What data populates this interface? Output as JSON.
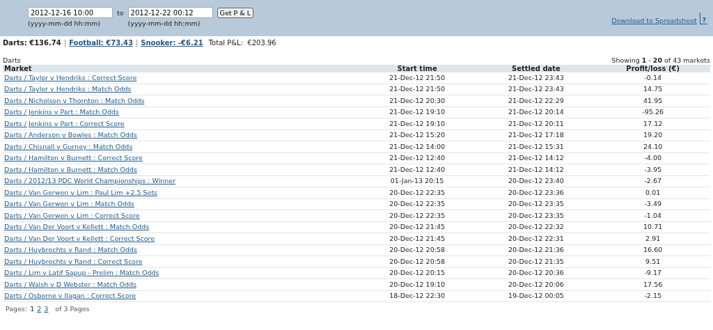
{
  "filter": {
    "from": "2012-12-16 10:00",
    "from_hint": "(yyyy-mm-dd hh:mm)",
    "to_label": "to",
    "to": "2012-12-22 00:12",
    "to_hint": "(yyyy-mm-dd hh:mm)",
    "button": "Get P & L",
    "download": "Download to Spreadsheet",
    "help": "?"
  },
  "summary": [
    {
      "label": "Darts: €136.74",
      "selected": true
    },
    {
      "label": "Football: €73.43",
      "selected": false
    },
    {
      "label": "Snooker: -€6.21",
      "selected": false
    }
  ],
  "separator": "|",
  "total": "Total P&L:  €203.96",
  "section": "Darts",
  "showing": "Showing **1** - **20** of 43 markets",
  "table": {
    "columns": [
      "Market",
      "Start time",
      "Settled date",
      "Profit/loss (€)"
    ],
    "rows": [
      [
        "Darts / Taylor v Hendriks : Correct Score",
        "21-Dec-12 21:50",
        "21-Dec-12 23:43",
        "-0.14"
      ],
      [
        "Darts / Taylor v Hendriks : Match Odds",
        "21-Dec-12 21:50",
        "21-Dec-12 23:43",
        "14.75"
      ],
      [
        "Darts / Nicholson v Thornton : Match Odds",
        "21-Dec-12 20:30",
        "21-Dec-12 22:29",
        "41.95"
      ],
      [
        "Darts / Jenkins v Part : Match Odds",
        "21-Dec-12 19:10",
        "21-Dec-12 20:14",
        "-95.26"
      ],
      [
        "Darts / Jenkins v Part : Correct Score",
        "21-Dec-12 19:10",
        "21-Dec-12 20:11",
        "17.12"
      ],
      [
        "Darts / Anderson v Bowles : Match Odds",
        "21-Dec-12 15:20",
        "21-Dec-12 17:18",
        "19.20"
      ],
      [
        "Darts / Chisnall v Gurney : Match Odds",
        "21-Dec-12 14:00",
        "21-Dec-12 15:31",
        "24.10"
      ],
      [
        "Darts / Hamilton v Burnett : Correct Score",
        "21-Dec-12 12:40",
        "21-Dec-12 14:12",
        "-4.00"
      ],
      [
        "Darts / Hamilton v Burnett : Match Odds",
        "21-Dec-12 12:40",
        "21-Dec-12 14:12",
        "-3.95"
      ],
      [
        "Darts / 2012/13 PDC World Championships : Winner",
        "01-Jan-13 20:15",
        "20-Dec-12 23:40",
        "-2.67"
      ],
      [
        "Darts / Van Gerwen v Lim : Paul Lim +2.5 Sets",
        "20-Dec-12 22:35",
        "20-Dec-12 23:36",
        "0.01"
      ],
      [
        "Darts / Van Gerwen v Lim : Match Odds",
        "20-Dec-12 22:35",
        "20-Dec-12 23:35",
        "-3.49"
      ],
      [
        "Darts / Van Gerwen v Lim : Correct Score",
        "20-Dec-12 22:35",
        "20-Dec-12 23:35",
        "-1.04"
      ],
      [
        "Darts / Van Der Voort v Kellett : Match Odds",
        "20-Dec-12 21:45",
        "20-Dec-12 22:32",
        "10.71"
      ],
      [
        "Darts / Van Der Voort v Kellett : Correct Score",
        "20-Dec-12 21:45",
        "20-Dec-12 22:31",
        "2.91"
      ],
      [
        "Darts / Huybrechts v Rand : Match Odds",
        "20-Dec-12 20:58",
        "20-Dec-12 21:36",
        "16.60"
      ],
      [
        "Darts / Huybrechts v Rand : Correct Score",
        "20-Dec-12 20:58",
        "20-Dec-12 21:35",
        "9.51"
      ],
      [
        "Darts / Lim v Latif Sapup - Prelim : Match Odds",
        "20-Dec-12 20:15",
        "20-Dec-12 20:36",
        "-9.17"
      ],
      [
        "Darts / Walsh v D Webster : Match Odds",
        "20-Dec-12 19:10",
        "20-Dec-12 20:06",
        "17.56"
      ],
      [
        "Darts / Osborne v Ilagan : Correct Score",
        "18-Dec-12 22:30",
        "19-Dec-12 00:05",
        "-2.15"
      ]
    ]
  },
  "pages_label": "Pages:",
  "pages": [
    {
      "label": "1",
      "selected": true
    },
    {
      "label": "2",
      "selected": false
    },
    {
      "label": "3",
      "selected": false
    }
  ],
  "pages_total": "of 3 Pages"
}
